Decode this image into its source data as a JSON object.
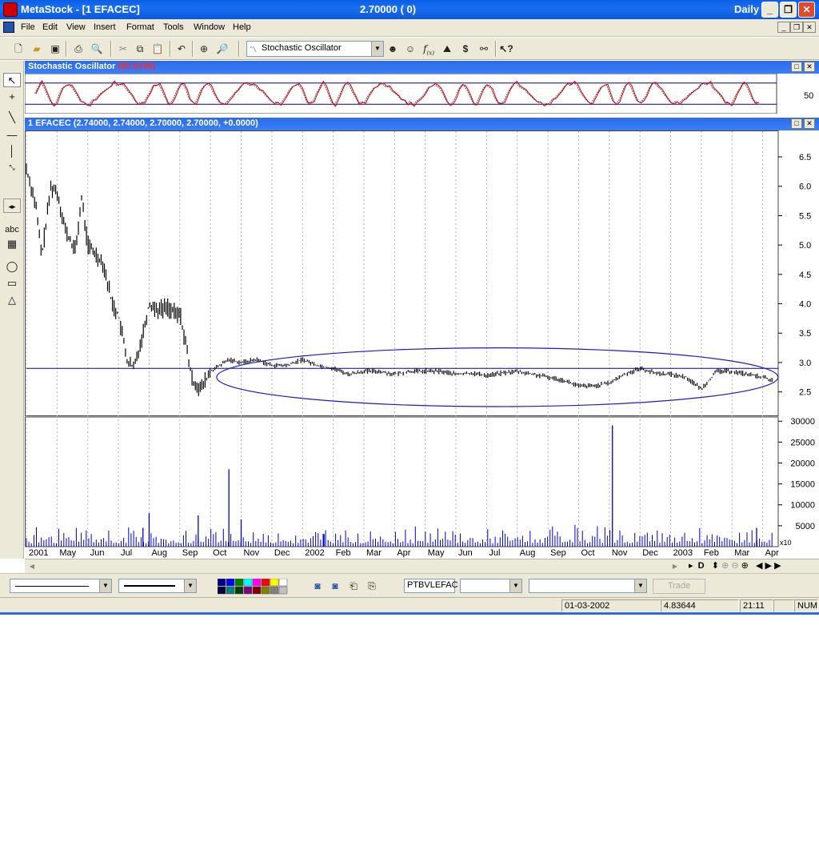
{
  "window": {
    "app_title": "MetaStock - [1 EFACEC]",
    "price_display": "2.70000 ( 0)",
    "periodicity": "Daily"
  },
  "menu": [
    "File",
    "Edit",
    "View",
    "Insert",
    "Format",
    "Tools",
    "Window",
    "Help"
  ],
  "toolbar": {
    "indicator_selected": "Stochastic Oscillator"
  },
  "stoch_pane": {
    "title": "Stochastic Oscillator",
    "value": "(60.9196)",
    "axis_label": "50"
  },
  "price_pane": {
    "title": "1 EFACEC (2.74000, 2.74000, 2.70000, 2.70000, +0.0000)"
  },
  "volume_pane": {
    "multiplier": "x10"
  },
  "bottom": {
    "symbol": "PTBVLEFAC",
    "trade_label": "Trade"
  },
  "status": {
    "date": "01-03-2002",
    "value": "4.83644",
    "time": "21:11",
    "num": "NUM"
  },
  "colors": {
    "price_bars": "#000000",
    "stoch_main": "#d40000",
    "stoch_signal": "#555555",
    "stoch_levels": "#0000aa",
    "volume": "#0000cc",
    "ellipse": "#1a1acc",
    "title_bar": "#1c6ff2"
  },
  "chart_data": [
    {
      "type": "line",
      "title": "Stochastic Oscillator",
      "series": [
        {
          "name": "Stochastic Oscillator",
          "note_value": 60.9196
        }
      ],
      "yticks": [
        "50"
      ],
      "levels": [
        80,
        20
      ],
      "ylim": [
        0,
        100
      ]
    },
    {
      "type": "line",
      "title": "1 EFACEC",
      "x_tick_labels": [
        "2001",
        "May",
        "Jun",
        "Jul",
        "Aug",
        "Sep",
        "Oct",
        "Nov",
        "Dec",
        "2002",
        "Feb",
        "Mar",
        "Apr",
        "May",
        "Jun",
        "Jul",
        "Aug",
        "Sep",
        "Oct",
        "Nov",
        "Dec",
        "2003",
        "Feb",
        "Mar",
        "Apr"
      ],
      "yticks": [
        "6.5",
        "6.0",
        "5.5",
        "5.0",
        "4.5",
        "4.0",
        "3.5",
        "3.0",
        "2.5"
      ],
      "ylim": [
        2.1,
        6.95
      ],
      "horizontal_line": 2.9,
      "x_month_index_range": [
        0,
        24.4
      ],
      "close": [
        [
          0.0,
          6.3
        ],
        [
          0.3,
          5.7
        ],
        [
          0.5,
          4.8
        ],
        [
          0.8,
          6.0
        ],
        [
          1.0,
          5.9
        ],
        [
          1.3,
          5.2
        ],
        [
          1.6,
          4.9
        ],
        [
          1.8,
          5.8
        ],
        [
          2.0,
          5.0
        ],
        [
          2.5,
          4.7
        ],
        [
          2.8,
          4.0
        ],
        [
          3.0,
          3.8
        ],
        [
          3.3,
          3.0
        ],
        [
          3.5,
          2.9
        ],
        [
          3.8,
          3.5
        ],
        [
          4.0,
          4.0
        ],
        [
          4.3,
          3.9
        ],
        [
          4.6,
          3.95
        ],
        [
          4.9,
          3.8
        ],
        [
          5.0,
          3.85
        ],
        [
          5.2,
          3.3
        ],
        [
          5.4,
          2.7
        ],
        [
          5.7,
          2.55
        ],
        [
          6.0,
          2.85
        ],
        [
          6.3,
          2.95
        ],
        [
          6.6,
          3.05
        ],
        [
          7.0,
          3.0
        ],
        [
          7.5,
          3.05
        ],
        [
          8.0,
          2.95
        ],
        [
          8.5,
          2.95
        ],
        [
          9.0,
          3.05
        ],
        [
          9.5,
          2.95
        ],
        [
          10.0,
          2.9
        ],
        [
          10.5,
          2.8
        ],
        [
          11.0,
          2.85
        ],
        [
          11.5,
          2.85
        ],
        [
          12.0,
          2.8
        ],
        [
          12.5,
          2.85
        ],
        [
          13.0,
          2.85
        ],
        [
          13.5,
          2.85
        ],
        [
          14.0,
          2.8
        ],
        [
          14.5,
          2.82
        ],
        [
          15.0,
          2.78
        ],
        [
          15.5,
          2.82
        ],
        [
          16.0,
          2.85
        ],
        [
          16.5,
          2.8
        ],
        [
          17.0,
          2.75
        ],
        [
          17.5,
          2.7
        ],
        [
          18.0,
          2.6
        ],
        [
          18.5,
          2.6
        ],
        [
          19.0,
          2.65
        ],
        [
          19.5,
          2.8
        ],
        [
          20.0,
          2.9
        ],
        [
          20.5,
          2.82
        ],
        [
          21.0,
          2.8
        ],
        [
          21.5,
          2.75
        ],
        [
          22.0,
          2.55
        ],
        [
          22.5,
          2.85
        ],
        [
          23.0,
          2.85
        ],
        [
          23.5,
          2.8
        ],
        [
          24.0,
          2.75
        ],
        [
          24.3,
          2.7
        ]
      ],
      "annotation": {
        "type": "ellipse",
        "x_range": [
          6.2,
          24.5
        ],
        "y_range": [
          2.25,
          3.25
        ]
      }
    },
    {
      "type": "bar",
      "title": "Volume",
      "yticks": [
        "30000",
        "25000",
        "20000",
        "15000",
        "10000",
        "5000"
      ],
      "ylim": [
        0,
        31000
      ],
      "spikes": [
        [
          6.6,
          18500
        ],
        [
          4.0,
          8000
        ],
        [
          5.6,
          7500
        ],
        [
          19.1,
          29000
        ],
        [
          7.0,
          6500
        ],
        [
          3.8,
          4500
        ],
        [
          23.8,
          4500
        ],
        [
          9.7,
          3000
        ]
      ]
    }
  ]
}
